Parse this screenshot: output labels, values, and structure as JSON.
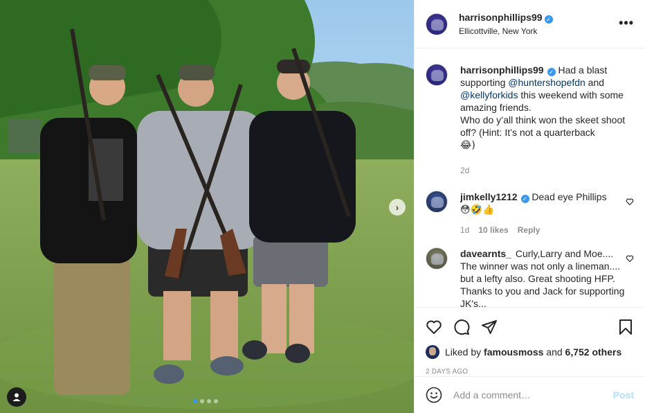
{
  "post": {
    "username": "harrisonphillips99",
    "location": "Ellicottville, New York",
    "caption_parts": {
      "text1": "Had a blast supporting ",
      "mention1": "@huntershopefdn",
      "text2": " and ",
      "mention2": "@kellyforkids",
      "text3": " this weekend with some amazing friends.",
      "text4": "Who do y’all think won the skeet shoot off? (Hint: It’s not a quarterback",
      "emoji": "😂)"
    },
    "caption_age": "2d"
  },
  "comments": [
    {
      "username": "jimkelly1212",
      "verified": true,
      "text": "Dead eye Phillips",
      "emoji_line": "😳🤣👍",
      "age": "1d",
      "likes": "10 likes",
      "reply": "Reply"
    },
    {
      "username": "davearnts_",
      "verified": false,
      "text": "Curly,Larry and Moe.... The winner was not only a lineman.... but a lefty also. Great shooting HFP. Thanks to you and",
      "text_cut": "Jack for supporting JK's..."
    }
  ],
  "actions": {
    "liked_by_prefix": "Liked by ",
    "liked_by_user": "famousmoss",
    "liked_by_mid": " and ",
    "liked_by_count": "6,752 others",
    "date": "2 DAYS AGO"
  },
  "comment_box": {
    "placeholder": "Add a comment…",
    "post_label": "Post"
  },
  "carousel": {
    "slide_count": 4,
    "active_slide": 1
  },
  "icons": {
    "more": "more-options-icon",
    "heart": "heart-icon",
    "comment": "comment-icon",
    "share": "share-icon",
    "save": "bookmark-icon",
    "emoji": "smiley-icon",
    "next": "chevron-right-icon",
    "tag": "user-tag-icon"
  },
  "colors": {
    "link": "#00376b",
    "verified": "#3897f0",
    "post_button": "#b2dffc",
    "muted": "#8e8e8e"
  }
}
